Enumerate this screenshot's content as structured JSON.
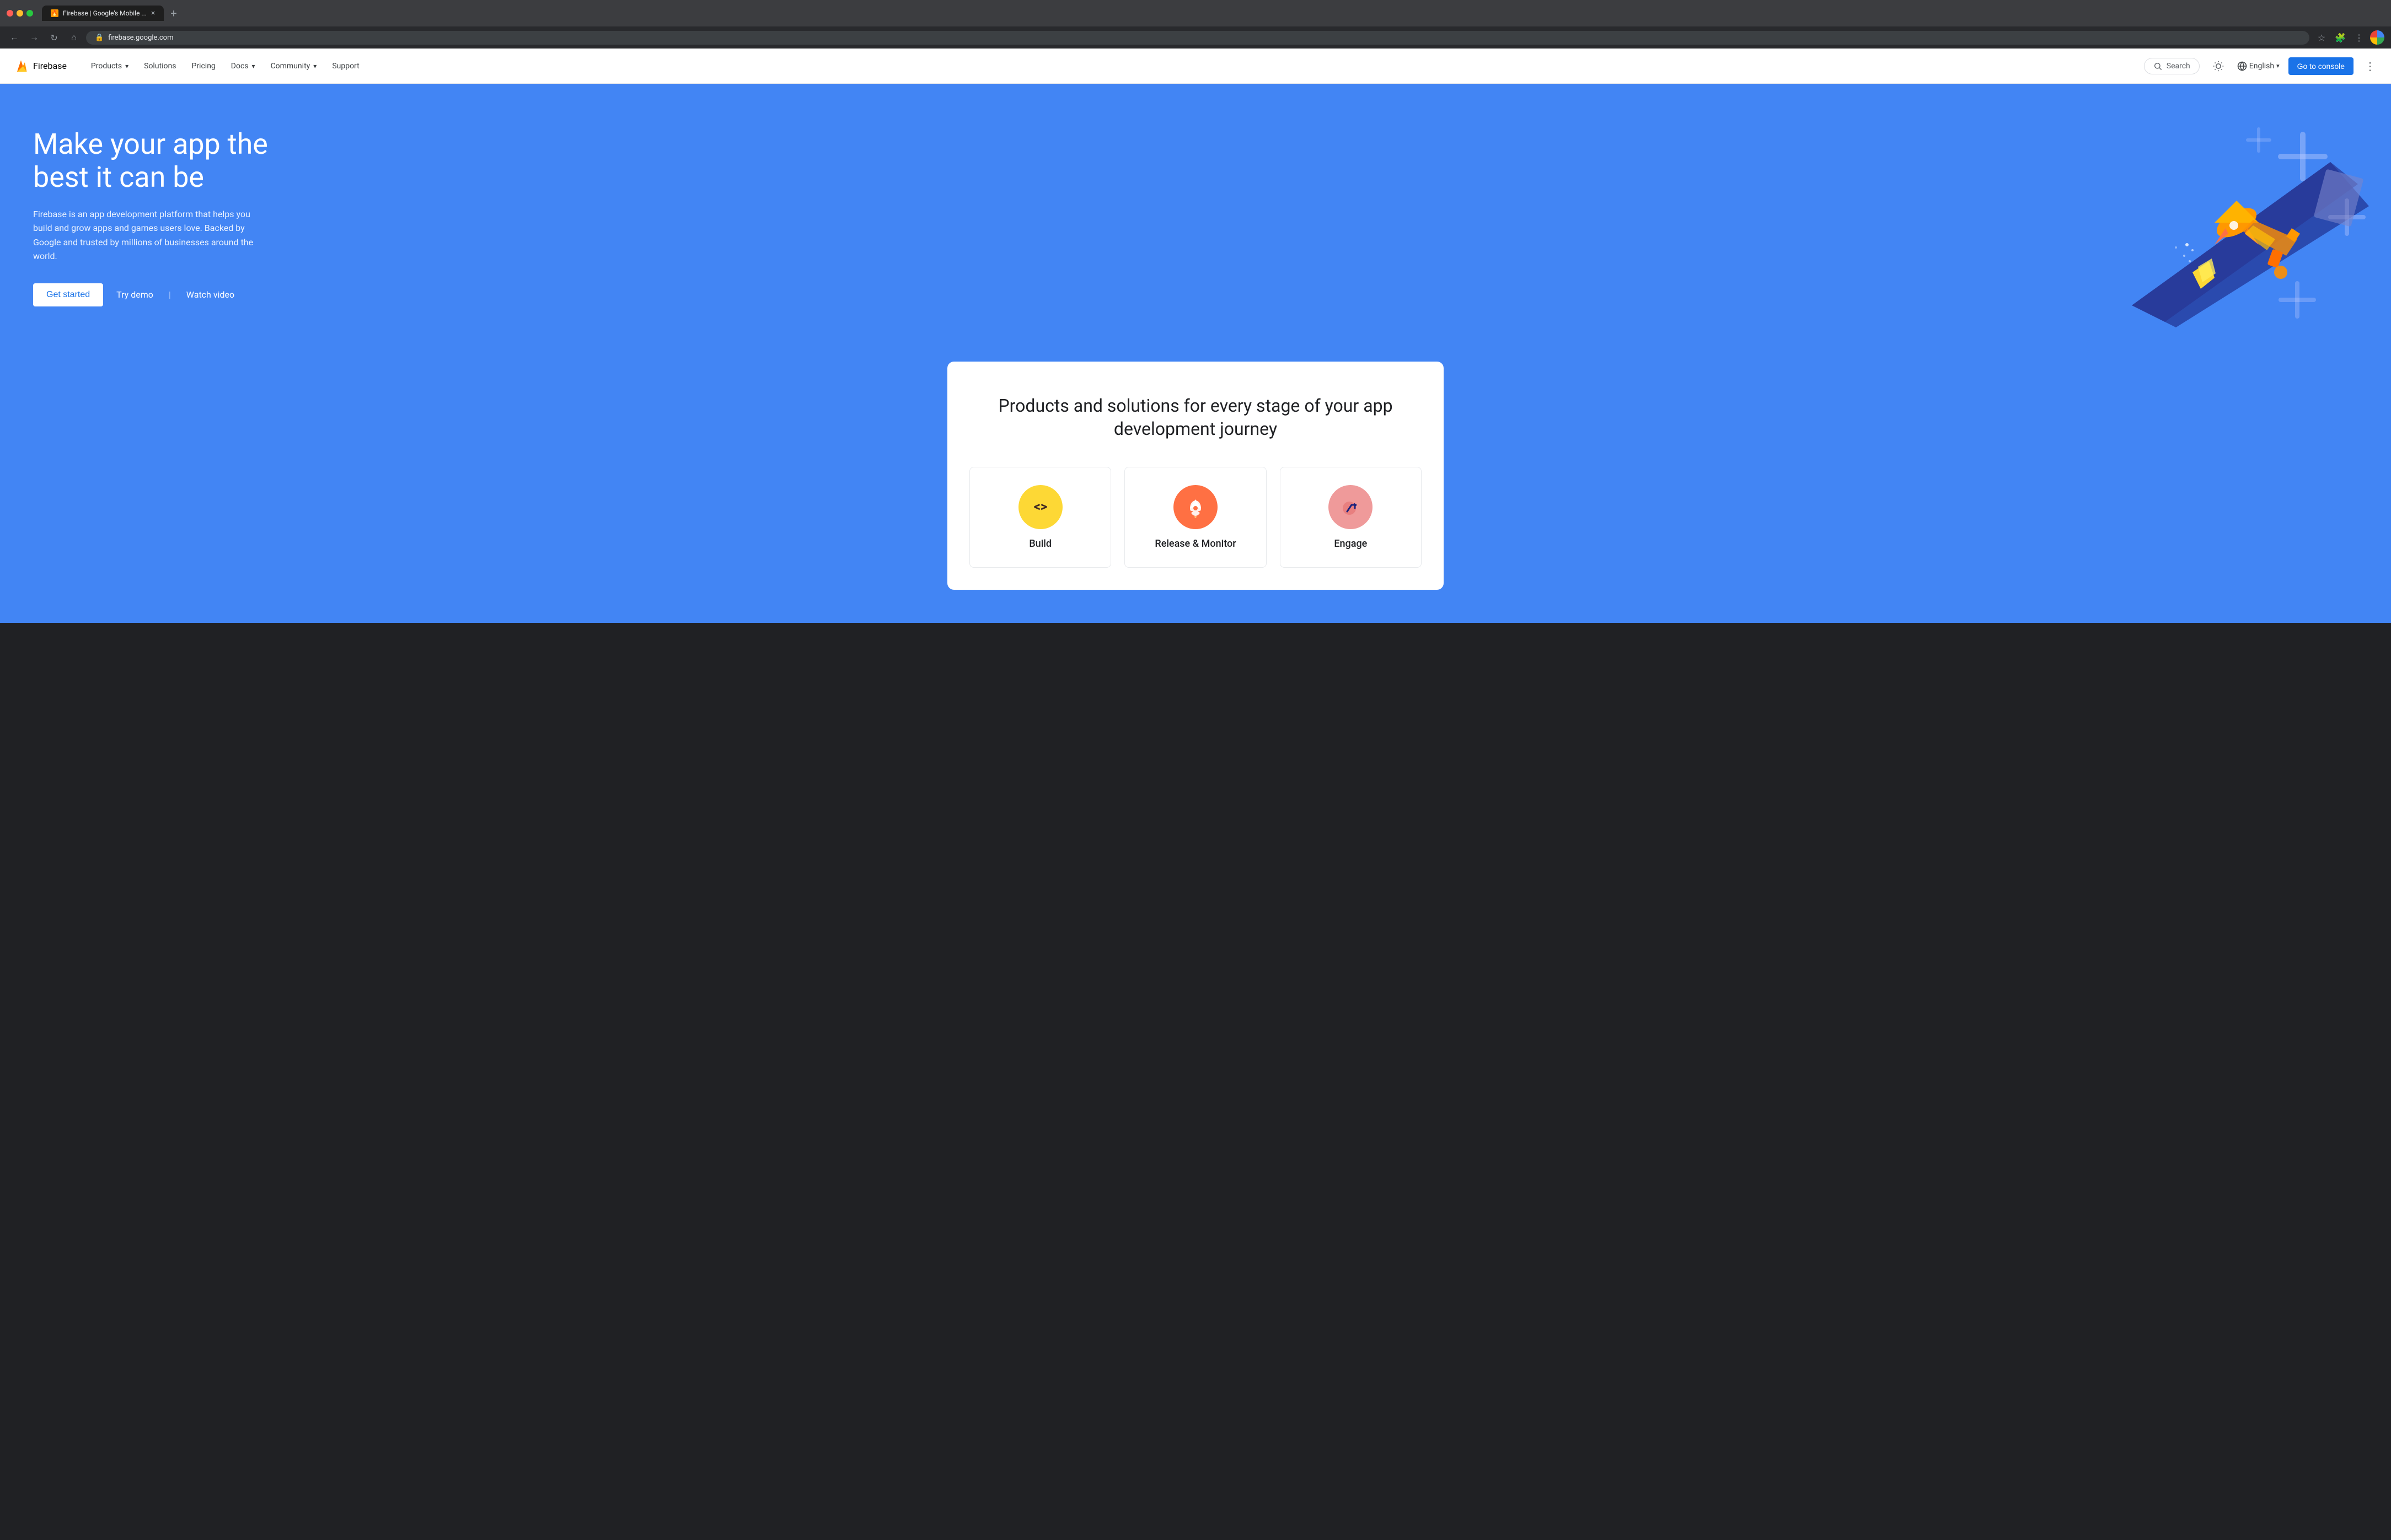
{
  "browser": {
    "tab_title": "Firebase | Google's Mobile ...",
    "tab_favicon": "🔥",
    "url": "firebase.google.com",
    "new_tab_label": "+",
    "close_tab_label": "×",
    "nav_back": "←",
    "nav_forward": "→",
    "nav_refresh": "↻",
    "nav_home": "⌂",
    "lock_icon": "🔒",
    "address": "firebase.google.com"
  },
  "nav": {
    "logo_text": "Firebase",
    "links": [
      {
        "label": "Products",
        "has_dropdown": true
      },
      {
        "label": "Solutions",
        "has_dropdown": false
      },
      {
        "label": "Pricing",
        "has_dropdown": false
      },
      {
        "label": "Docs",
        "has_dropdown": true
      },
      {
        "label": "Community",
        "has_dropdown": true
      },
      {
        "label": "Support",
        "has_dropdown": false
      }
    ],
    "search_placeholder": "Search",
    "language": "English",
    "console_label": "Go to console"
  },
  "hero": {
    "title": "Make your app the best it can be",
    "description": "Firebase is an app development platform that helps you build and grow apps and games users love. Backed by Google and trusted by millions of businesses around the world.",
    "cta_primary": "Get started",
    "cta_secondary": "Try demo",
    "cta_tertiary": "Watch video"
  },
  "products_section": {
    "title": "Products and solutions for every stage of your app development journey",
    "cards": [
      {
        "name": "Build",
        "icon": "◁▷",
        "icon_type": "code"
      },
      {
        "name": "Release & Monitor",
        "icon": "🚀",
        "icon_type": "rocket"
      },
      {
        "name": "Engage",
        "icon": "📈",
        "icon_type": "chart"
      }
    ]
  },
  "colors": {
    "hero_bg": "#4285f4",
    "nav_bg": "#ffffff",
    "card_bg": "#ffffff",
    "primary_blue": "#1a73e8",
    "text_dark": "#202124",
    "text_medium": "#3c4043",
    "text_light": "#5f6368"
  }
}
